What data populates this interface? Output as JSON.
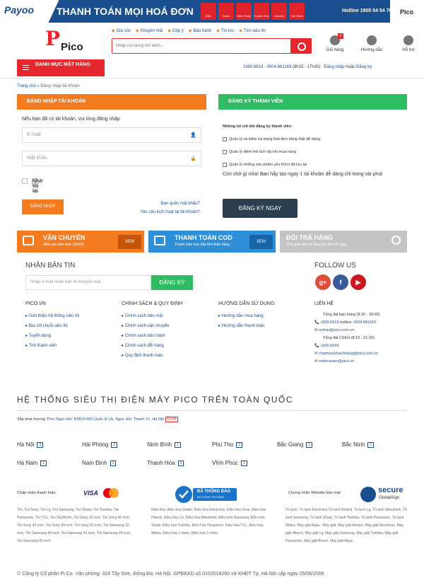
{
  "banner": {
    "brand": "Payoo",
    "title": "THANH TOÁN MỌI HOÁ ĐƠN",
    "icons": [
      "Điện",
      "Nước",
      "Điện Thoại",
      "Truyền Hình",
      "Internet",
      "Tài Chính"
    ],
    "hotline": "Hotline 1900 54 54 78",
    "partner": "Pico"
  },
  "header": {
    "logo_text": "Pico",
    "links": [
      {
        "icon": "tag-icon",
        "label": "Giá sốc"
      },
      {
        "icon": "gift-icon",
        "label": "Khuyến mãi"
      },
      {
        "icon": "comment-icon",
        "label": "Góp ý"
      },
      {
        "icon": "wrench-icon",
        "label": "Bảo hành"
      },
      {
        "icon": "news-icon",
        "label": "Tin tức"
      },
      {
        "icon": "location-icon",
        "label": "Tìm siêu thị"
      }
    ],
    "search_placeholder": "Nhập nội dung tìm kiếm...",
    "cart_label": "Giỏ hàng",
    "cart_count": "0",
    "guide_label": "Hướng dẫn",
    "support_label": "Hỗ trợ",
    "category_label": "DANH MỤC MẶT HÀNG",
    "phones": "1900.6619 - 0904.881169",
    "hours": "(8h15 - 17h30)",
    "login": "Đăng nhập",
    "or": "hoặc",
    "register": "Đăng ký"
  },
  "breadcrumb": {
    "home": "Trang chủ",
    "current": "Đăng nhập tài khoản"
  },
  "login": {
    "heading": "ĐĂNG NHẬP TÀI KHOẢN",
    "intro": "Nếu bạn đã có tài khoản, vui lòng đăng nhập",
    "email_placeholder": "E-mail",
    "password_placeholder": "Mật khẩu",
    "remember": "Nhớ tôi lại",
    "submit": "ĐĂNG NHẬP",
    "forgot": "Bạn quên mật khẩu?",
    "activation": "Yêu cầu kích hoạt lại tài khoản?"
  },
  "register": {
    "heading": "ĐĂNG KÝ THÀNH VIÊN",
    "benefits_title": "Những lợi ích khi đăng ký thành viên:",
    "benefits": [
      "Quản lý và kiểm tra trạng thái đơn hàng thật dễ dàng",
      "Quản lý điểm thẻ tích lũy khi mua hàng",
      "Quản lý những sản phẩm yêu thích đã lưu lại"
    ],
    "cta_text": "Còn chờ gì nữa! Bạn hãy tạo ngay 1 tài khoản dễ dàng chỉ trong vài phút",
    "button": "ĐĂNG KÝ NGAY"
  },
  "features": [
    {
      "title": "VẬN CHUYỂN",
      "sub": "Miễn phí Bán kính 200KM",
      "button": "XEM",
      "color": "#f47b20"
    },
    {
      "title": "THANH TOÁN COD",
      "sub": "Thanh toán trực tiếp khi nhận hàng",
      "button": "XEM",
      "color": "#2e8fd8"
    },
    {
      "title": "ĐỔI TRẢ HÀNG",
      "sub": "Thời gian đổi trả hàng lên đến 30 ngày",
      "color": "#bdbdbd"
    }
  ],
  "newsletter": {
    "title": "NHẬN BẢN TIN",
    "placeholder": "Nhập e-mail nhận bản tin khuyến mại...",
    "button": "ĐĂNG KÝ"
  },
  "follow": {
    "title": "FOLLOW US",
    "icons": [
      "google-plus-icon",
      "facebook-icon",
      "youtube-icon"
    ]
  },
  "footer_cols": [
    {
      "title": "PICO.VN",
      "items": [
        "Giới thiệu hệ thống siêu thị",
        "Địa chỉ chuỗi siêu thị",
        "Tuyển dụng",
        "Thẻ thành viên"
      ]
    },
    {
      "title": "CHÍNH SÁCH & QUY ĐỊNH",
      "items": [
        "Chính sách bảo mật",
        "Chính sách vận chuyển",
        "Chính sách bảo hành",
        "Chính sách đổi hàng",
        "Quy định thanh toán"
      ]
    },
    {
      "title": "HƯỚNG DẪN SỬ DỤNG",
      "items": [
        "Hướng dẫn mua hàng",
        "Hướng dẫn thanh toán"
      ]
    }
  ],
  "contact": {
    "title": "LIÊN HỆ",
    "sales_label": "Tổng đài bán hàng (8:15 - 18:00)",
    "sales_phone1": "1900.6619",
    "sales_hotline": "hotline:",
    "sales_phone2": "0904.881169",
    "online_email": "online@pico.com.vn",
    "cskh_label": "Tổng đài CSKH (8:15 - 21:30)",
    "cskh_phone": "1900.6699",
    "care_email": "chamsockhachhang@pico.com.vn",
    "webmaster_email": "webmaster@pico.vn"
  },
  "stores": {
    "title": "HỆ THỐNG SIÊU THỊ ĐIỆN MÁY PICO TRÊN TOÀN QUỐC",
    "opening_label": "Sắp khai trương:",
    "opening_store": "Pico Ngọc Hồi: KM13+500 Quốc lộ 1A, Ngọc Hồi, Thanh Trì, Hà Nội",
    "opening_date": "31/08",
    "cities": [
      {
        "name": "Hà Nội",
        "count": "9"
      },
      {
        "name": "Hải Phòng",
        "count": "2"
      },
      {
        "name": "Ninh Bình",
        "count": "1"
      },
      {
        "name": "Phú Thọ",
        "count": "2"
      },
      {
        "name": "Bắc Giang",
        "count": "1"
      },
      {
        "name": "Bắc Ninh",
        "count": "1"
      },
      {
        "name": "Hà Nam",
        "count": "1"
      },
      {
        "name": "Nam Định",
        "count": "1"
      },
      {
        "name": "Thanh Hóa",
        "count": "1"
      },
      {
        "name": "Vĩnh Phúc",
        "count": "1"
      }
    ]
  },
  "bottom": {
    "payment_label": "Chấp nhận thanh toán:",
    "visa": "VISA",
    "mastercard": "MasterCard",
    "bct_line1": "ĐÃ THÔNG BÁO",
    "bct_line2": "BỘ CÔNG THƯƠNG",
    "secure_label": "Chứng nhận Website bảo mật:",
    "secure_brand": "secure",
    "secure_sub": "GlobalSign",
    "tv_keywords": "Tivi, Tivi Sony, Tivi Lg, Tivi Samsung, Tivi Sharp, Tivi Toshiba, Tivi Panasonic, Tivi TCL, Tivi SkyWorth, Tivi Sony 32 inch, Tivi Sony 40 inch, Tivi Sony 43 inch, Tivi Sony 49 inch, Tivi Sony 55 inch, Tivi Samsung 32 inch, Tivi Samsung 40 inch, Tivi Samsung 43 inch, Tivi Samsung 49 inch, Tivi Samsung 55 inch",
    "ac_keywords": "Điều hòa, Điều hòa Daikin, Điều hòa Electrolux, Điều hòa Gree, Điều hòa Hitachi, Điều hòa LG, Điều hòa Mitsubishi, Điều hòa Samsung, Điều hòa Sharp, Điều hòa Toshiba, Điều hòa Panasonic, Điều hòa TCL, Điều hòa Midea, Điều hòa 1 chiều, Điều hòa 2 chiều",
    "fridge_keywords": "Tủ lạnh, Tủ lạnh Electrolux,Tủ lạnh Hitachi, Tủ lạnh Lg, Tủ lạnh Mitsubishi, Tủ lạnh Samsung, Tủ lạnh Sharp, Tủ lạnh Toshiba, Tủ lạnh Panasonic, Tủ lạnh Midea, Máy giặt Aqua - Máy giặt, Máy giặt Ariston, Máy giặt Electrolux, Máy giặt Hitachi, Máy giặt Lg, Máy giặt Samsung, Máy giặt Toshiba, Máy giặt Panasonic, Máy giặt Bosch, Máy giặt Aqua",
    "copyright": "© Công ty Cổ phần Pi Co. Văn phòng: 324 Tây Sơn, Đống Đa, Hà Nội. GPĐKKD số 0102018260 sở KHĐT Tp. Hà Nội cấp ngày 25/08/2006"
  }
}
